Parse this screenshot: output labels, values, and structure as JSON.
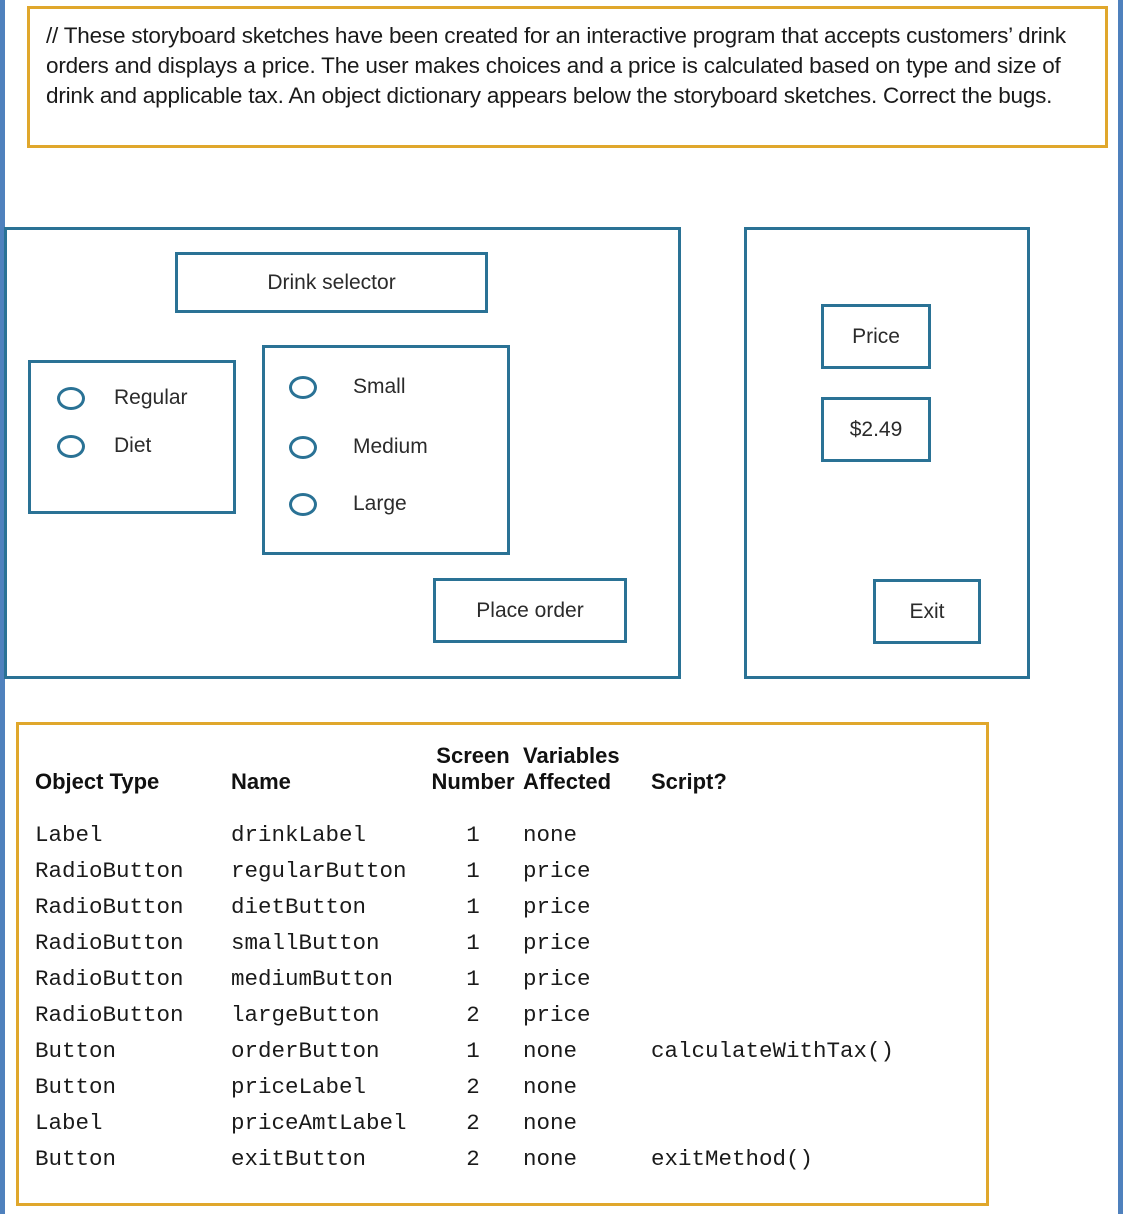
{
  "comment": {
    "text": "// These storyboard sketches have been created for an interactive program that accepts customers’ drink orders and displays a price. The user makes choices and a price is calculated based on type and size of drink and applicable tax. An object dictionary appears below the storyboard sketches. Correct the bugs."
  },
  "colors": {
    "sketch_outline": "#2a7295",
    "comment_border": "#e0a72c",
    "dictionary_border": "#e0a72c",
    "page_rail": "#4f81bd",
    "text": "#1a1a1a"
  },
  "screens": [
    {
      "number": 1,
      "drink_label": "Drink selector",
      "type_group": {
        "options": [
          {
            "label": "Regular"
          },
          {
            "label": "Diet"
          }
        ]
      },
      "size_group": {
        "options": [
          {
            "label": "Small"
          },
          {
            "label": "Medium"
          },
          {
            "label": "Large"
          }
        ]
      },
      "order_button": "Place order"
    },
    {
      "number": 2,
      "price_label": "Price",
      "price_amount": "$2.49",
      "exit_button": "Exit"
    }
  ],
  "dictionary": {
    "headers": {
      "object_type": "Object Type",
      "name": "Name",
      "screen_number": "Screen\nNumber",
      "variables_affected": "Variables\nAffected",
      "script": "Script?"
    },
    "rows": [
      {
        "object_type": "Label",
        "name": "drinkLabel",
        "screen_number": "1",
        "variables_affected": "none",
        "script": ""
      },
      {
        "object_type": "RadioButton",
        "name": "regularButton",
        "screen_number": "1",
        "variables_affected": "price",
        "script": ""
      },
      {
        "object_type": "RadioButton",
        "name": "dietButton",
        "screen_number": "1",
        "variables_affected": "price",
        "script": ""
      },
      {
        "object_type": "RadioButton",
        "name": "smallButton",
        "screen_number": "1",
        "variables_affected": "price",
        "script": ""
      },
      {
        "object_type": "RadioButton",
        "name": "mediumButton",
        "screen_number": "1",
        "variables_affected": "price",
        "script": ""
      },
      {
        "object_type": "RadioButton",
        "name": "largeButton",
        "screen_number": "2",
        "variables_affected": "price",
        "script": ""
      },
      {
        "object_type": "Button",
        "name": "orderButton",
        "screen_number": "1",
        "variables_affected": "none",
        "script": "calculateWithTax()"
      },
      {
        "object_type": "Button",
        "name": "priceLabel",
        "screen_number": "2",
        "variables_affected": "none",
        "script": ""
      },
      {
        "object_type": "Label",
        "name": "priceAmtLabel",
        "screen_number": "2",
        "variables_affected": "none",
        "script": ""
      },
      {
        "object_type": "Button",
        "name": "exitButton",
        "screen_number": "2",
        "variables_affected": "none",
        "script": "exitMethod()"
      }
    ]
  }
}
